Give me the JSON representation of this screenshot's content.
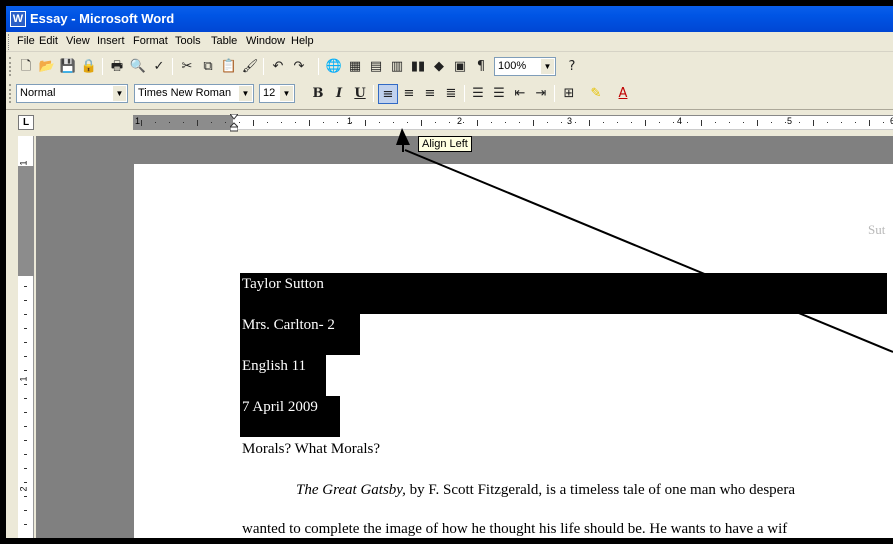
{
  "window": {
    "title": "Essay - Microsoft Word",
    "icon": "word-app-icon"
  },
  "menubar": {
    "items": [
      "File",
      "Edit",
      "View",
      "Insert",
      "Format",
      "Tools",
      "Table",
      "Window",
      "Help"
    ]
  },
  "standard_toolbar": {
    "zoom": "100%",
    "icons": [
      "new-document-icon",
      "open-folder-icon",
      "save-icon",
      "permission-icon",
      "print-icon",
      "print-preview-icon",
      "spelling-icon",
      "cut-icon",
      "copy-icon",
      "paste-icon",
      "format-painter-icon",
      "undo-icon",
      "redo-icon",
      "hyperlink-icon",
      "tables-borders-icon",
      "insert-table-icon",
      "insert-excel-icon",
      "columns-icon",
      "drawing-icon",
      "document-map-icon",
      "show-formatting-icon",
      "help-icon"
    ]
  },
  "formatting_toolbar": {
    "style": "Normal",
    "font": "Times New Roman",
    "size": "12",
    "bold": "B",
    "italic": "I",
    "underline": "U"
  },
  "ruler": {
    "numbers": [
      "1",
      "1",
      "2",
      "3",
      "4",
      "5",
      "6"
    ]
  },
  "vruler": {
    "numbers": [
      "1",
      "1",
      "2"
    ]
  },
  "tooltip": {
    "text": "Align Left"
  },
  "document": {
    "header": "Sut",
    "lines": {
      "name": "Taylor Sutton",
      "teacher": "Mrs. Carlton- 2",
      "class": "English 11",
      "date": "7 April 2009",
      "title": "Morals? What Morals?",
      "p1_book": "The Great Gatsby,",
      "p1_rest": " by F. Scott Fitzgerald, is a timeless tale of one man who despera",
      "p2": "wanted to complete the image of how he thought his life should be. He wants to have a wif"
    }
  }
}
